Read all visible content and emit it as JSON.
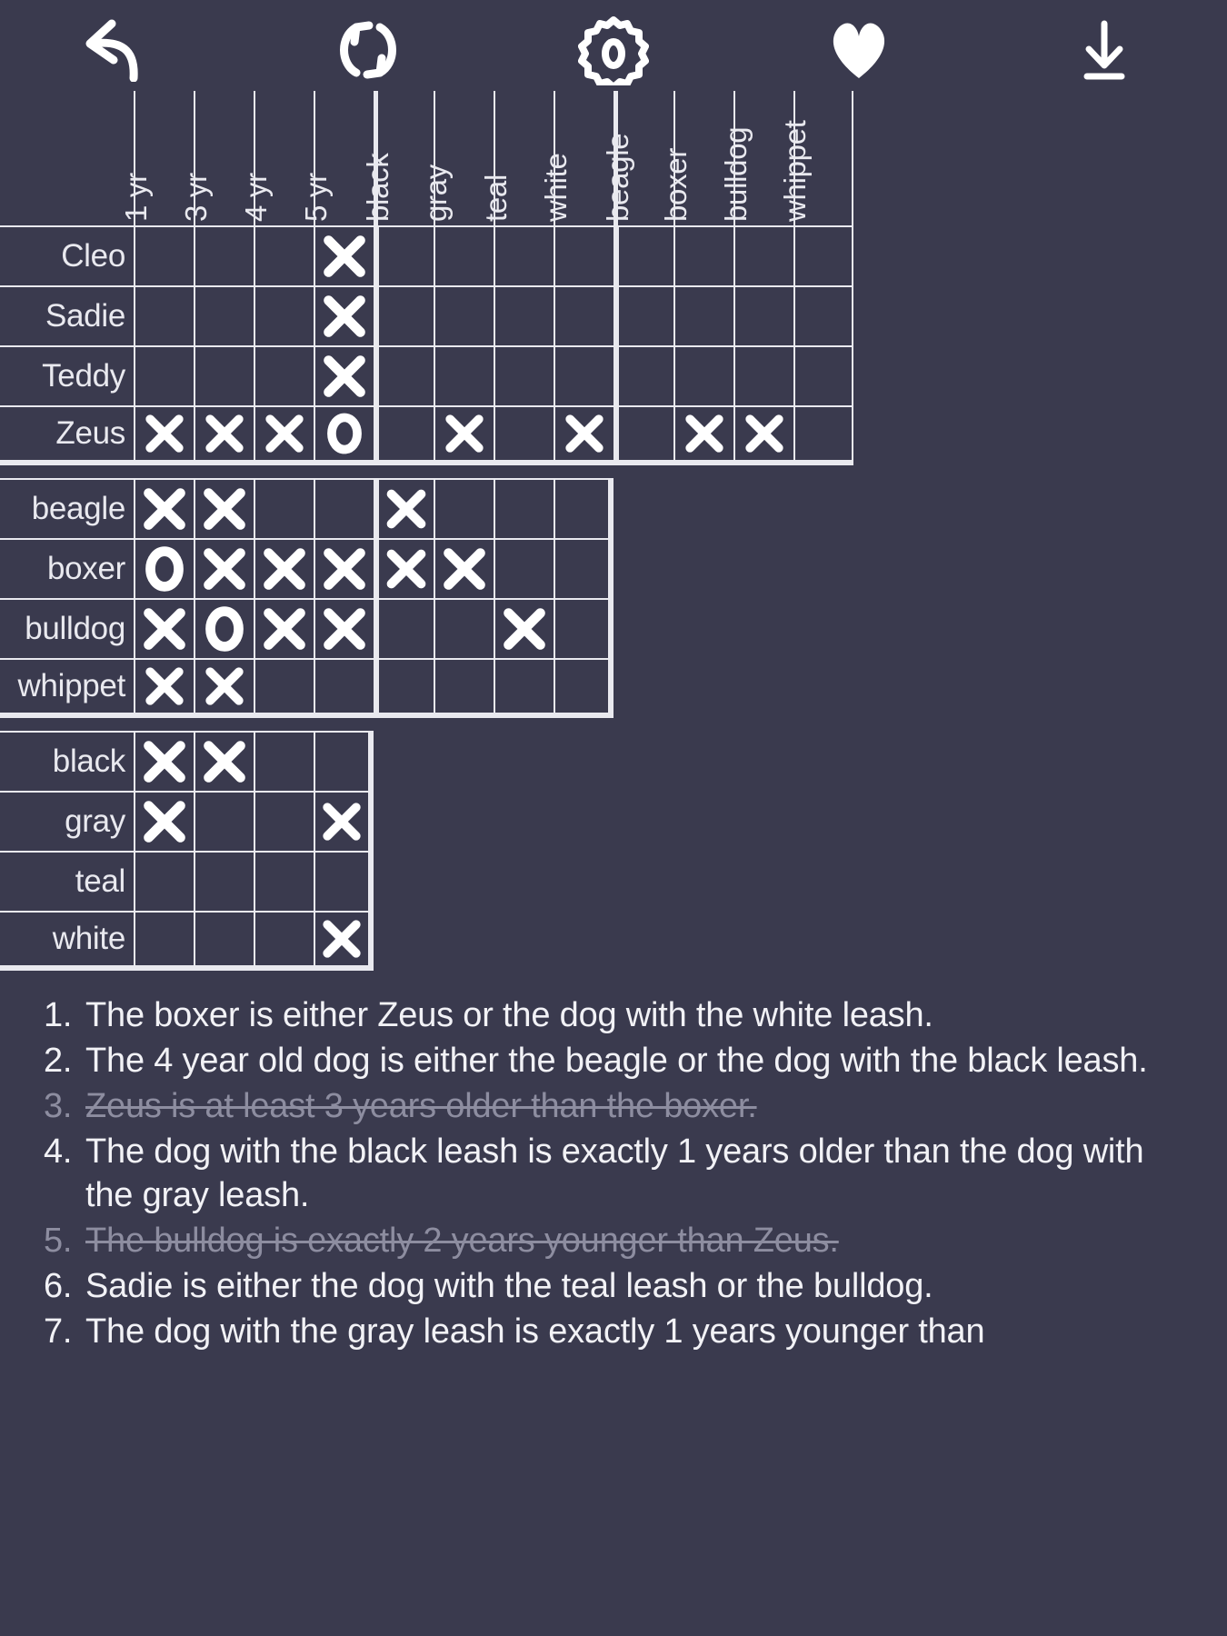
{
  "app": {
    "background_color": "#3a3a4e",
    "foreground_color": "#e9e9ef",
    "muted_color": "#8d8da0"
  },
  "toolbar": {
    "buttons": [
      {
        "name": "undo-button",
        "icon": "undo-arrow-icon",
        "label": "Undo"
      },
      {
        "name": "restart-button",
        "icon": "refresh-icon",
        "label": "Restart"
      },
      {
        "name": "settings-button",
        "icon": "gear-icon",
        "label": "Settings"
      },
      {
        "name": "favorite-button",
        "icon": "heart-icon",
        "label": "Favorite"
      },
      {
        "name": "download-button",
        "icon": "download-arrow-icon",
        "label": "Download"
      }
    ]
  },
  "grid": {
    "column_groups": [
      {
        "name": "age",
        "headers": [
          "1 yr",
          "3 yr",
          "4 yr",
          "5 yr"
        ]
      },
      {
        "name": "leash",
        "headers": [
          "black",
          "gray",
          "teal",
          "white"
        ]
      },
      {
        "name": "breed",
        "headers": [
          "beagle",
          "boxer",
          "bulldog",
          "whippet"
        ]
      }
    ],
    "row_groups": [
      {
        "name": "dog",
        "labels": [
          "Cleo",
          "Sadie",
          "Teddy",
          "Zeus"
        ]
      },
      {
        "name": "breed",
        "labels": [
          "beagle",
          "boxer",
          "bulldog",
          "whippet"
        ]
      },
      {
        "name": "leash",
        "labels": [
          "black",
          "gray",
          "teal",
          "white"
        ]
      }
    ],
    "marks": {
      "legend": {
        "x": "X - eliminated",
        "o": "O - confirmed",
        "": "empty"
      },
      "dog_rows": [
        {
          "label": "Cleo",
          "age": [
            "",
            "",
            "",
            "x"
          ],
          "leash": [
            "",
            "",
            "",
            ""
          ],
          "breed": [
            "",
            "",
            "",
            ""
          ]
        },
        {
          "label": "Sadie",
          "age": [
            "",
            "",
            "",
            "x"
          ],
          "leash": [
            "",
            "",
            "",
            ""
          ],
          "breed": [
            "",
            "",
            "",
            ""
          ]
        },
        {
          "label": "Teddy",
          "age": [
            "",
            "",
            "",
            "x"
          ],
          "leash": [
            "",
            "",
            "",
            ""
          ],
          "breed": [
            "",
            "",
            "",
            ""
          ]
        },
        {
          "label": "Zeus",
          "age": [
            "x",
            "x",
            "x",
            "o"
          ],
          "leash": [
            "",
            "x",
            "",
            "x"
          ],
          "breed": [
            "",
            "x",
            "x",
            ""
          ]
        }
      ],
      "breed_rows": [
        {
          "label": "beagle",
          "age": [
            "x",
            "x",
            "",
            ""
          ],
          "leash": [
            "x",
            "",
            "",
            ""
          ]
        },
        {
          "label": "boxer",
          "age": [
            "o",
            "x",
            "x",
            "x"
          ],
          "leash": [
            "x",
            "x",
            "",
            ""
          ]
        },
        {
          "label": "bulldog",
          "age": [
            "x",
            "o",
            "x",
            "x"
          ],
          "leash": [
            "",
            "",
            "x",
            ""
          ]
        },
        {
          "label": "whippet",
          "age": [
            "x",
            "x",
            "",
            ""
          ],
          "leash": [
            "",
            "",
            "",
            ""
          ]
        }
      ],
      "leash_rows": [
        {
          "label": "black",
          "age": [
            "x",
            "x",
            "",
            ""
          ]
        },
        {
          "label": "gray",
          "age": [
            "x",
            "",
            "",
            "x"
          ]
        },
        {
          "label": "teal",
          "age": [
            "",
            "",
            "",
            ""
          ]
        },
        {
          "label": "white",
          "age": [
            "",
            "",
            "",
            "x"
          ]
        }
      ]
    }
  },
  "clues": [
    {
      "number": "1.",
      "text": "The boxer is either Zeus or the dog with the white leash.",
      "solved": false
    },
    {
      "number": "2.",
      "text": "The 4 year old dog is either the beagle or the dog with the black leash.",
      "solved": false
    },
    {
      "number": "3.",
      "text": "Zeus is at least 3 years older than the boxer.",
      "solved": true
    },
    {
      "number": "4.",
      "text": "The dog with the black leash is exactly 1 years older than the dog with the gray leash.",
      "solved": false
    },
    {
      "number": "5.",
      "text": "The bulldog is exactly 2 years younger than Zeus.",
      "solved": true
    },
    {
      "number": "6.",
      "text": "Sadie is either the dog with the teal leash or the bulldog.",
      "solved": false
    },
    {
      "number": "7.",
      "text": "The dog with the gray leash is exactly 1 years younger than",
      "solved": false
    }
  ]
}
